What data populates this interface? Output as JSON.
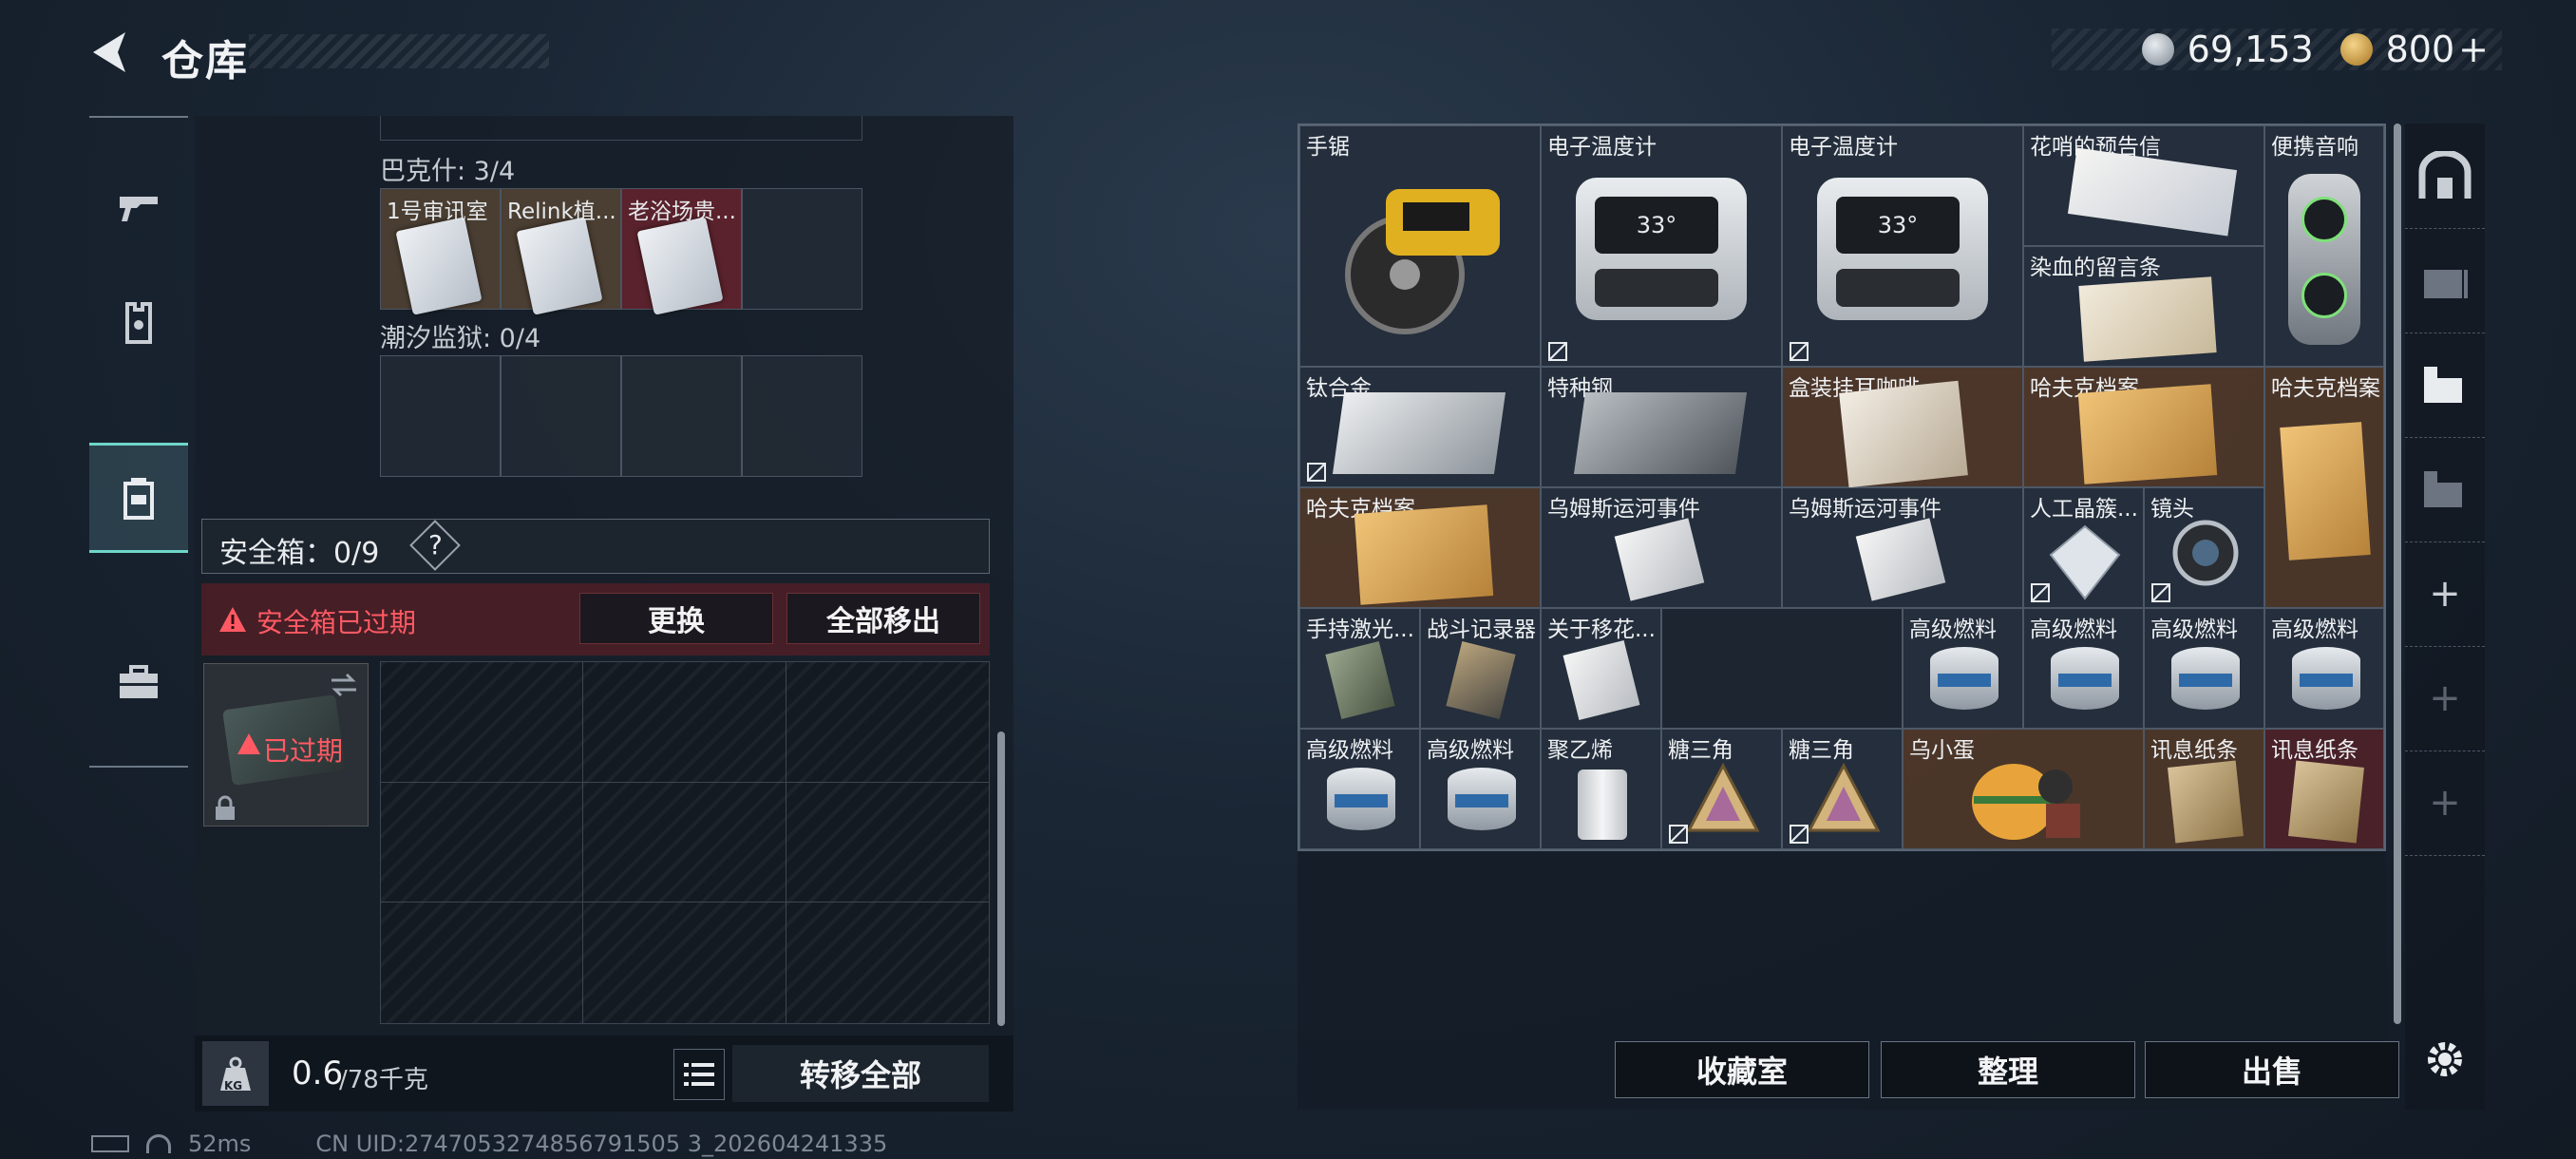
{
  "header": {
    "title": "仓库",
    "currency1": "69,153",
    "currency2": "800",
    "currency2_plus": "+"
  },
  "left": {
    "section1": "巴克什: 3/4",
    "section1_items": [
      "1号审讯室",
      "Relink植...",
      "老浴场贵..."
    ],
    "section2": "潮汐监狱: 0/4",
    "safe_label": "安全箱：0/9",
    "safe_help": "?",
    "warning": "安全箱已过期",
    "btn_replace": "更换",
    "btn_remove_all": "全部移出",
    "expired": "已过期",
    "weight_value": "0.6",
    "weight_max": "/78千克",
    "weight_icon_text": "KG",
    "transfer_all": "转移全部"
  },
  "storage": {
    "items": {
      "saw": "手锯",
      "therm1": "电子温度计",
      "therm2": "电子温度计",
      "letter": "花哨的预告信",
      "speaker": "便携音响",
      "bloodnote": "染血的留言条",
      "titanium": "钛合金",
      "steel": "特种钢",
      "coffee": "盒装挂耳咖啡",
      "haf1": "哈夫克档案",
      "haf2": "哈夫克档案",
      "haf3": "哈夫克档案",
      "canal1": "乌姆斯运河事件",
      "canal2": "乌姆斯运河事件",
      "crystal": "人工晶簇...",
      "lens": "镜头",
      "laser": "手持激光...",
      "recorder": "战斗记录器",
      "about": "关于移花...",
      "fuel1": "高级燃料",
      "fuel2": "高级燃料",
      "fuel3": "高级燃料",
      "fuel4": "高级燃料",
      "fuel5": "高级燃料",
      "fuel6": "高级燃料",
      "poly": "聚乙烯",
      "tri1": "糖三角",
      "tri2": "糖三角",
      "egg": "乌小蛋",
      "paper1": "讯息纸条",
      "paper2": "讯息纸条"
    },
    "thermometer_display": "33°"
  },
  "actions": {
    "collection": "收藏室",
    "sort": "整理",
    "sell": "出售"
  },
  "status": {
    "ping": "52ms",
    "uid": "CN UID:2747053274856791505 3_202604241335"
  },
  "colors": {
    "accent": "#6fd6c9",
    "warning": "#e5474f",
    "brown_item": "#5c3e28",
    "red_item": "#602228"
  }
}
